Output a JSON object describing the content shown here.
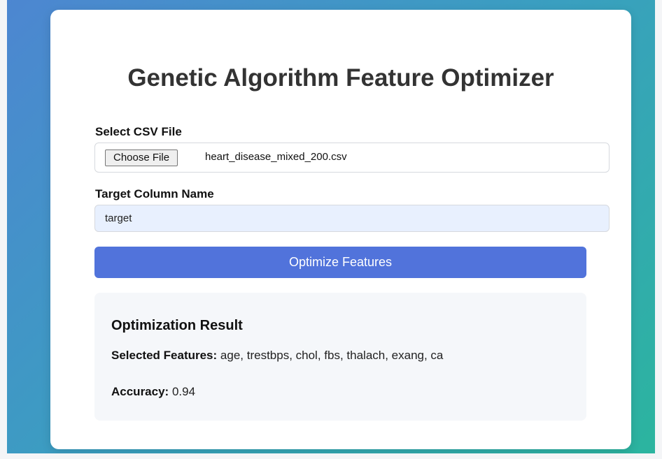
{
  "page": {
    "title": "Genetic Algorithm Feature Optimizer"
  },
  "file_section": {
    "label": "Select CSV File",
    "button_label": "Choose File",
    "file_name": "heart_disease_mixed_200.csv"
  },
  "target_section": {
    "label": "Target Column Name",
    "value": "target"
  },
  "optimize_button": {
    "label": "Optimize Features"
  },
  "result": {
    "title": "Optimization Result",
    "selected_label": "Selected Features:",
    "selected_value": "age, trestbps, chol, fbs, thalach, exang, ca",
    "accuracy_label": "Accuracy:",
    "accuracy_value": "0.94"
  },
  "colors": {
    "primary_button": "#5173db",
    "input_autofill": "#e8f0fe",
    "result_background": "#f5f7fa"
  }
}
